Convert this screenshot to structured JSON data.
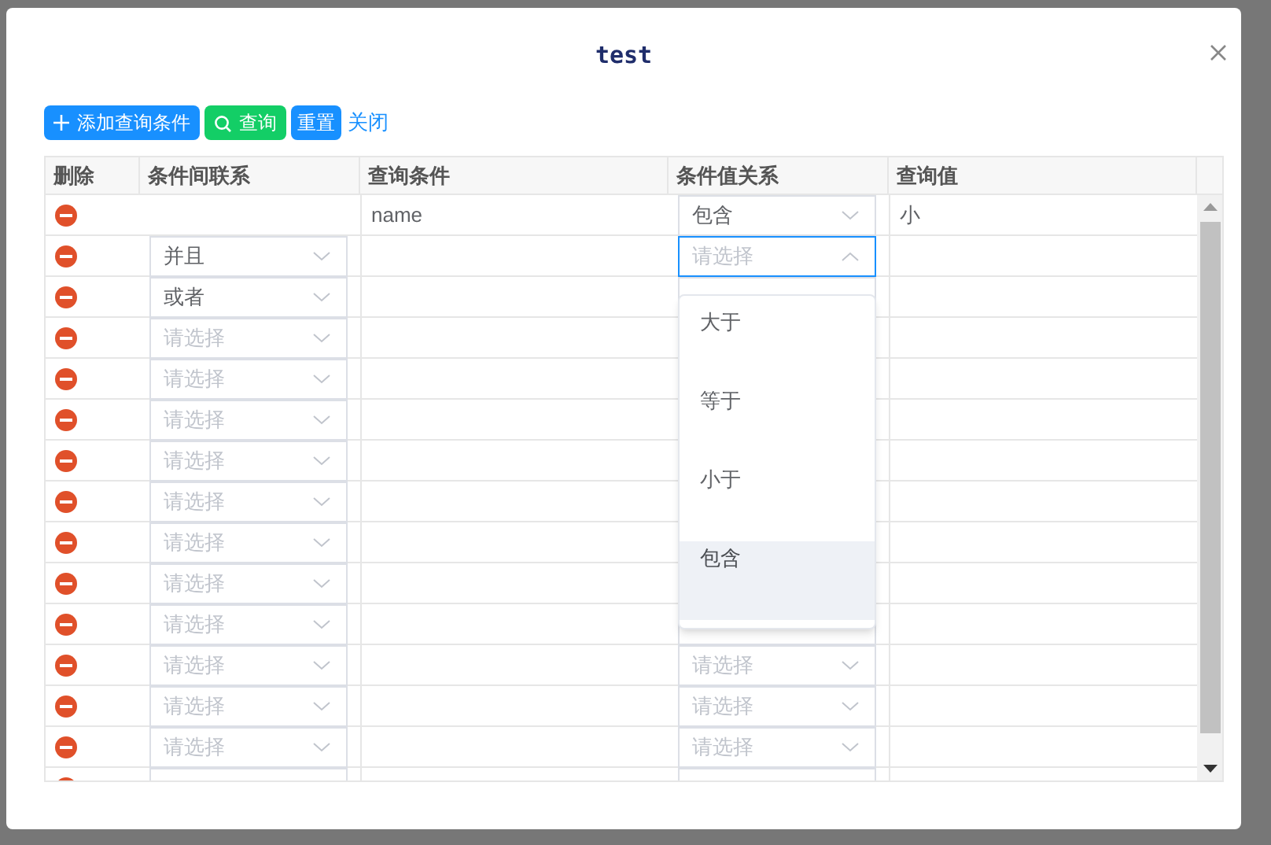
{
  "dialog": {
    "title": "test"
  },
  "toolbar": [
    {
      "kind": "add",
      "label": "添加查询条件"
    },
    {
      "kind": "search",
      "label": "查询"
    },
    {
      "kind": "reset",
      "label": "重置"
    },
    {
      "kind": "link",
      "label": "关闭"
    }
  ],
  "table": {
    "columns": [
      "删除",
      "条件间联系",
      "查询条件",
      "条件值关系",
      "查询值"
    ],
    "rows": [
      {
        "relation": null,
        "condition": "name",
        "value_relation": {
          "value": "包含",
          "open": false
        },
        "value": "小"
      },
      {
        "relation": {
          "value": "并且"
        },
        "condition": "",
        "value_relation": {
          "placeholder": "请选择",
          "open": true
        }
      },
      {
        "relation": {
          "value": "或者"
        },
        "value_relation": {}
      },
      {
        "relation": {
          "placeholder": "请选择"
        }
      },
      {
        "relation": {
          "placeholder": "请选择"
        }
      },
      {
        "relation": {
          "placeholder": "请选择"
        }
      },
      {
        "relation": {
          "placeholder": "请选择"
        }
      },
      {
        "relation": {
          "placeholder": "请选择"
        }
      },
      {
        "relation": {
          "placeholder": "请选择"
        }
      },
      {
        "relation": {
          "placeholder": "请选择"
        }
      },
      {
        "relation": {
          "placeholder": "请选择"
        },
        "value_relation": {}
      },
      {
        "relation": {
          "placeholder": "请选择"
        },
        "value_relation": {
          "placeholder": "请选择",
          "open": false
        }
      },
      {
        "relation": {
          "placeholder": "请选择"
        },
        "value_relation": {
          "placeholder": "请选择",
          "open": false
        }
      },
      {
        "relation": {
          "placeholder": "请选择"
        },
        "value_relation": {
          "placeholder": "请选择",
          "open": false
        }
      },
      {
        "relation": {},
        "value_relation": {}
      }
    ]
  },
  "dropdown": {
    "options": [
      {
        "label": "大于",
        "highlighted": false
      },
      {
        "label": "等于",
        "highlighted": false
      },
      {
        "label": "小于",
        "highlighted": false
      },
      {
        "label": "包含",
        "highlighted": true
      }
    ]
  }
}
